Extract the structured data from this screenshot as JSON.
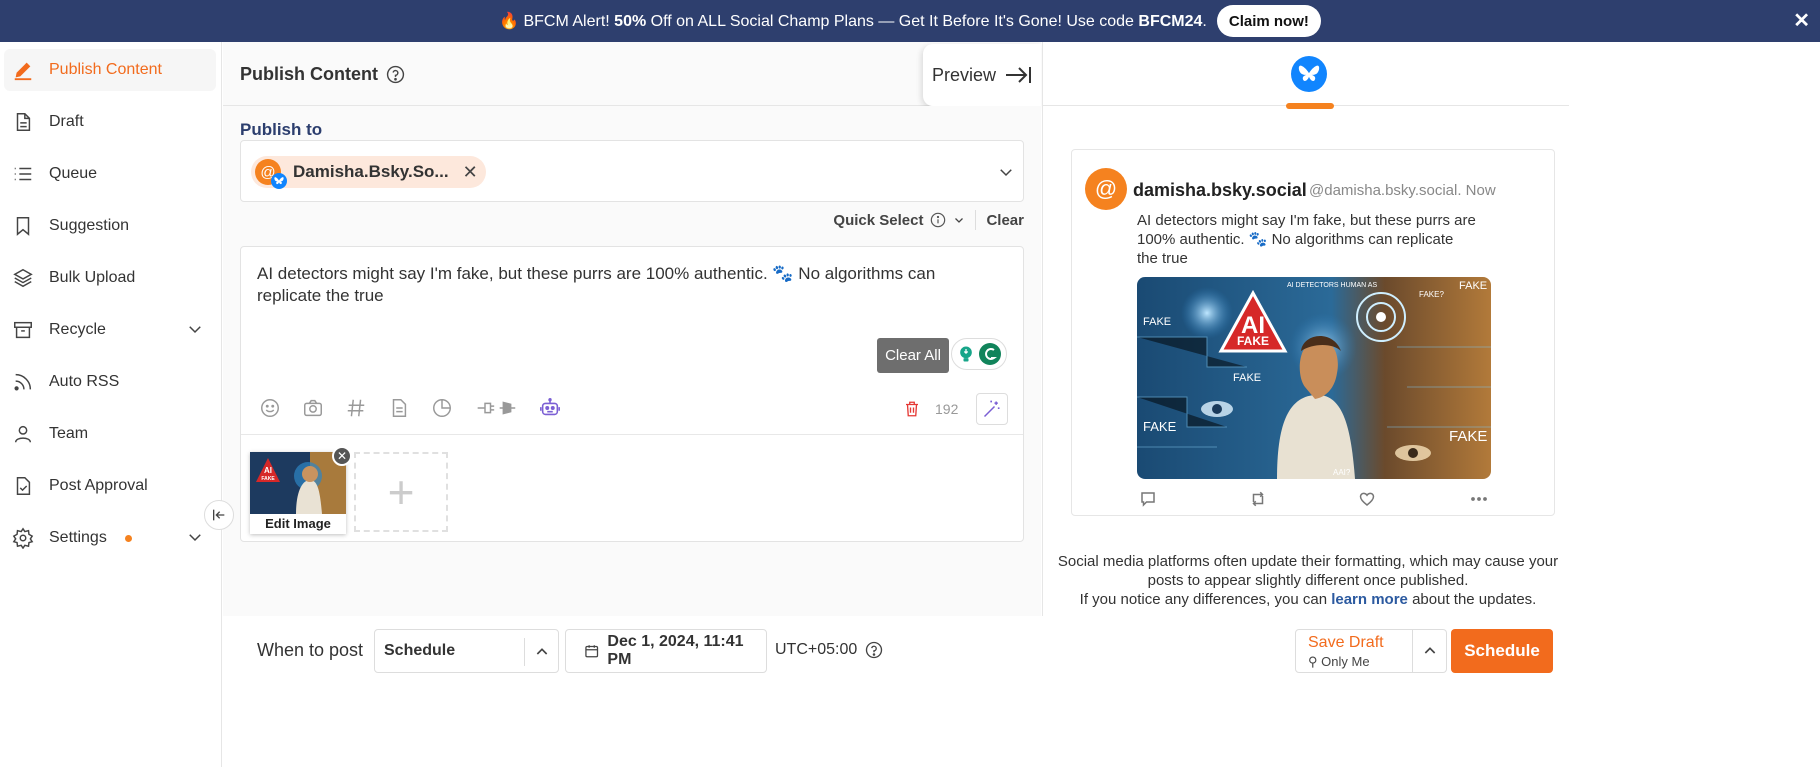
{
  "banner": {
    "emoji": "🔥",
    "text_pre": "BFCM Alert! ",
    "text_bold": "50%",
    "text_mid": " Off on ALL Social Champ Plans — Get It Before It's Gone! Use code ",
    "code": "BFCM24",
    "text_end": ".",
    "claim_label": "Claim now!",
    "close_label": "✕"
  },
  "sidebar": {
    "items": [
      {
        "label": "Publish Content",
        "icon": "pencil-icon"
      },
      {
        "label": "Draft",
        "icon": "document-icon"
      },
      {
        "label": "Queue",
        "icon": "list-icon"
      },
      {
        "label": "Suggestion",
        "icon": "bookmark-icon"
      },
      {
        "label": "Bulk Upload",
        "icon": "layers-icon"
      },
      {
        "label": "Recycle",
        "icon": "archive-icon"
      },
      {
        "label": "Auto RSS",
        "icon": "rss-icon"
      },
      {
        "label": "Team",
        "icon": "user-icon"
      },
      {
        "label": "Post Approval",
        "icon": "approval-icon"
      },
      {
        "label": "Settings",
        "icon": "gear-icon"
      }
    ]
  },
  "header": {
    "title": "Publish Content",
    "preview_label": "Preview"
  },
  "composer": {
    "publish_to_label": "Publish to",
    "account_chip": "Damisha.Bsky.So...",
    "quick_select_label": "Quick Select",
    "clear_label": "Clear",
    "post_text": "AI detectors might say I'm fake, but these purrs are 100% authentic. 🐾 No algorithms can replicate the true",
    "clear_all_label": "Clear All",
    "char_count": "192",
    "edit_image_label": "Edit Image",
    "add_media_label": "+"
  },
  "bottom_bar": {
    "when_to_post_label": "When to post",
    "schedule_option": "Schedule",
    "date_value": "Dec 1, 2024, 11:41 PM",
    "timezone": "UTC+05:00",
    "save_draft_label": "Save Draft",
    "save_draft_visibility": "Only Me",
    "schedule_button_label": "Schedule"
  },
  "preview": {
    "display_name": "damisha.bsky.social",
    "handle_time": "@damisha.bsky.social. Now",
    "post_text": "AI detectors might say I'm fake, but these purrs are 100% authentic. 🐾 No algorithms can replicate the true",
    "note_line1": "Social media platforms often update their formatting, which may cause your posts to appear slightly different once published.",
    "note_line2_pre": "If you notice any differences, you can ",
    "note_link": "learn more",
    "note_line2_post": " about the updates."
  },
  "image_text": {
    "badge_top": "AI",
    "badge_bottom": "FAKE",
    "header_text": "AI DETECTORS HUMAN AS",
    "labels": [
      "FAKE",
      "FAKE",
      "FAKE",
      "FAKE",
      "FAKE",
      "FAKE?",
      "AAI?"
    ]
  },
  "colors": {
    "accent": "#f26b1d",
    "banner_bg": "#2e3f6e",
    "bluesky": "#1185fe"
  }
}
